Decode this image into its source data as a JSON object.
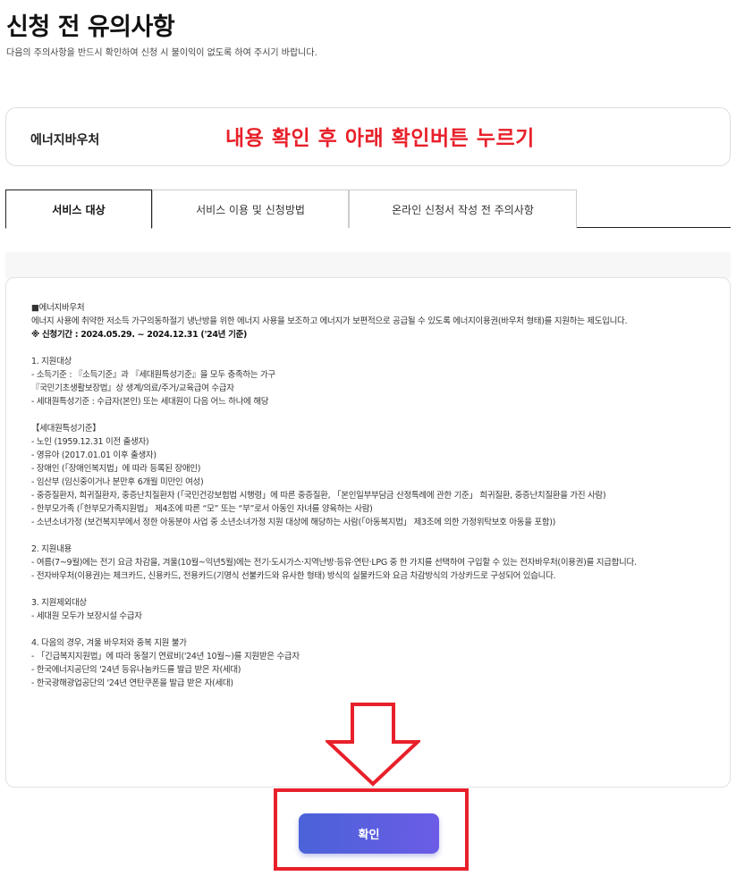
{
  "header": {
    "title": "신청 전 유의사항",
    "subtitle": "다음의 주의사항을 반드시 확인하여 신청 시 불이익이 없도록 하여 주시기 바랍니다."
  },
  "voucher": {
    "name": "에너지바우처",
    "instruction": "내용 확인 후 아래 확인버튼 누르기",
    "instruction_color": "#e8202a"
  },
  "tabs": [
    {
      "label": "서비스 대상",
      "active": true
    },
    {
      "label": "서비스 이용 및 신청방법",
      "active": false
    },
    {
      "label": "온라인 신청서 작성 전 주의사항",
      "active": false
    }
  ],
  "content": {
    "lines": [
      "■에너지바우처",
      "에너지 사용에 취약한 저소득 가구의동하절기 냉난방을 위한 에너지 사용을 보조하고 에너지가 보편적으로 공급될 수 있도록 에너지이용권(바우처 형태)를 지원하는 제도입니다.",
      "※ 신청기간 : 2024.05.29. ~ 2024.12.31 ('24년 기준)",
      "",
      "1. 지원대상",
      "- 소득기준 : 『소득기준』과 『세대원특성기준』을 모두 충족하는 가구",
      "『국민기초생활보장법』상 생계/의료/주거/교육급여 수급자",
      "- 세대원특성기준 : 수급자(본인) 또는 세대원이 다음 어느 하나에 해당",
      "",
      "【세대원특성기준】",
      "- 노인 (1959.12.31 이전 출생자)",
      "- 영유아 (2017.01.01 이후 출생자)",
      "- 장애인 (「장애인복지법」에 따라 등록된 장애인)",
      "- 임산부 (임신중이거나 분만후 6개월 미만인 여성)",
      "- 중증질환자, 희귀질환자, 중증난치질환자 (「국민건강보험법 시행령」에 따른 중증질환, 「본인일부부담금 산정특례에 관한 기준」 희귀질환, 중증난치질환을 가진 사람)",
      "- 한부모가족 (「한부모가족지원법」 제4조에 따른 “모” 또는 “부”로서 아동인 자녀를 양육하는 사람)",
      "- 소년소녀가정 (보건복지부에서 정한 아동분야 사업 중 소년소녀가정 지원 대상에 해당하는 사람(「아동복지법」 제3조에 의한 가정위탁보호 아동을 포함))",
      "",
      "2. 지원내용",
      "- 여름(7~9월)에는 전기 요금 차감을, 겨울(10월~익년5월)에는 전기·도시가스·지역난방·등유·연탄·LPG 중 한 가지를 선택하여 구입할 수 있는 전자바우처(이용권)를 지급합니다.",
      "- 전자바우처(이용권)는 체크카드, 신용카드, 전용카드(기명식 선불카드와 유사한 형태) 방식의 실물카드와 요금 차감방식의 가상카드로 구성되어 있습니다.",
      "",
      "3. 지원제외대상",
      "- 세대원 모두가 보장시설 수급자",
      "",
      "4. 다음의 경우, 겨울 바우처와 중복 지원 불가",
      "- 「긴급복지지원법」에 따라 동절기 연료비('24년 10월~)를 지원받은 수급자",
      "- 한국에너지공단의 '24년 등유나눔카드를 발급 받은 자(세대)",
      "- 한국광해광업공단의 '24년 연탄쿠폰을 발급 받은 자(세대)"
    ]
  },
  "annotation": {
    "arrow_icon": "down-arrow-outline-icon",
    "highlight_color": "#e8202a"
  },
  "confirm_button": {
    "label": "확인",
    "gradient_start": "#4a62d8",
    "gradient_end": "#6b5ce6"
  }
}
